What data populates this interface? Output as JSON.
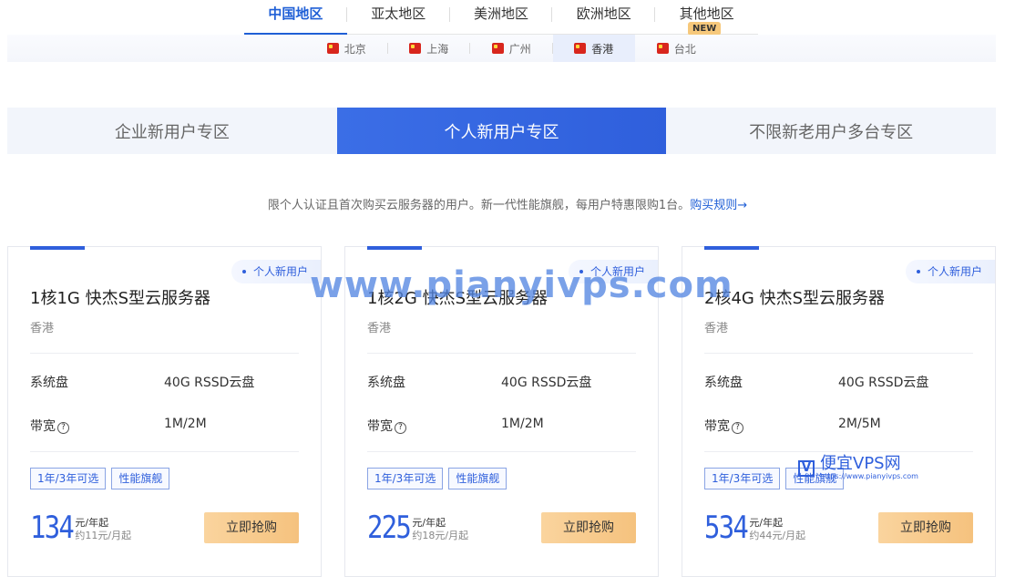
{
  "regions": [
    {
      "label": "中国地区",
      "active": true
    },
    {
      "label": "亚太地区",
      "active": false
    },
    {
      "label": "美洲地区",
      "active": false
    },
    {
      "label": "欧洲地区",
      "active": false
    },
    {
      "label": "其他地区",
      "active": false
    }
  ],
  "new_badge": "NEW",
  "cities": [
    {
      "label": "北京",
      "active": false
    },
    {
      "label": "上海",
      "active": false
    },
    {
      "label": "广州",
      "active": false
    },
    {
      "label": "香港",
      "active": true
    },
    {
      "label": "台北",
      "active": false
    }
  ],
  "zones": [
    {
      "label": "企业新用户专区",
      "active": false
    },
    {
      "label": "个人新用户专区",
      "active": true
    },
    {
      "label": "不限新老用户多台专区",
      "active": false
    }
  ],
  "description": {
    "text": "限个人认证且首次购买云服务器的用户。新一代性能旗舰，每用户特惠限购1台。",
    "link": "购买规则→"
  },
  "cards": [
    {
      "tag": "个人新用户",
      "title": "1核1G 快杰S型云服务器",
      "location": "香港",
      "disk_label": "系统盘",
      "disk_value": "40G RSSD云盘",
      "bandwidth_label": "带宽",
      "bandwidth_value": "1M/2M",
      "chips": [
        "1年/3年可选",
        "性能旗舰"
      ],
      "price": "134",
      "price_unit": "元/年起",
      "price_month": "约11元/月起",
      "buy": "立即抢购"
    },
    {
      "tag": "个人新用户",
      "title": "1核2G 快杰S型云服务器",
      "location": "香港",
      "disk_label": "系统盘",
      "disk_value": "40G RSSD云盘",
      "bandwidth_label": "带宽",
      "bandwidth_value": "1M/2M",
      "chips": [
        "1年/3年可选",
        "性能旗舰"
      ],
      "price": "225",
      "price_unit": "元/年起",
      "price_month": "约18元/月起",
      "buy": "立即抢购"
    },
    {
      "tag": "个人新用户",
      "title": "2核4G 快杰S型云服务器",
      "location": "香港",
      "disk_label": "系统盘",
      "disk_value": "40G RSSD云盘",
      "bandwidth_label": "带宽",
      "bandwidth_value": "2M/5M",
      "chips": [
        "1年/3年可选",
        "性能旗舰"
      ],
      "price": "534",
      "price_unit": "元/年起",
      "price_month": "约44元/月起",
      "buy": "立即抢购"
    }
  ],
  "watermark": {
    "text": "www.pianyivps.com",
    "logo_letter": "V",
    "logo_title": "便宜VPS网",
    "logo_url": "https://www.pianyivps.com"
  },
  "colors": {
    "accent": "#2f5fdc",
    "buy": "#f5c27e"
  }
}
